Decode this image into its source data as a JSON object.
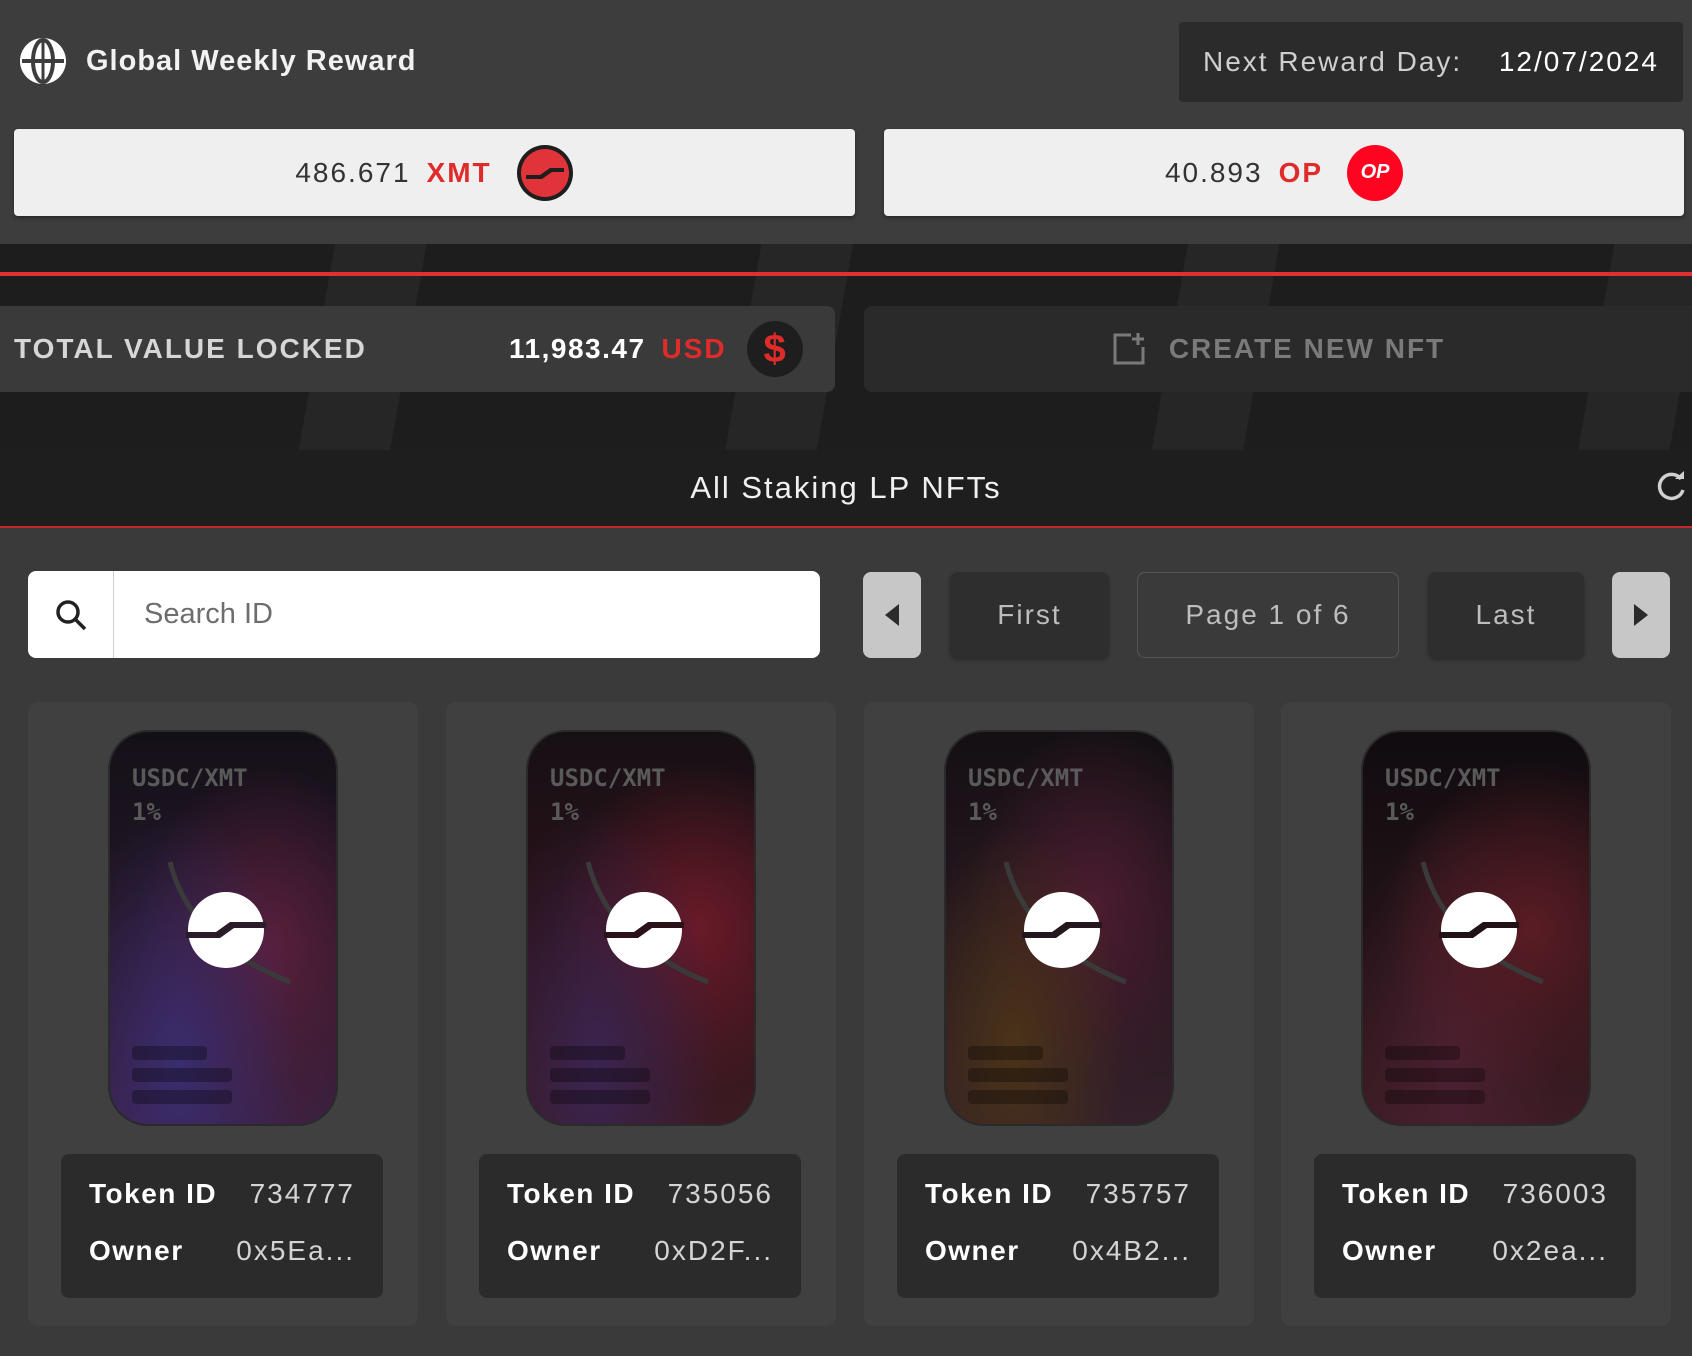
{
  "reward": {
    "title": "Global Weekly Reward",
    "next_label": "Next Reward Day:",
    "next_date": "12/07/2024",
    "xmt_amount": "486.671",
    "xmt_symbol": "XMT",
    "op_amount": "40.893",
    "op_symbol": "OP",
    "op_coin_text": "OP"
  },
  "tvl": {
    "label": "TOTAL VALUE LOCKED",
    "value": "11,983.47",
    "unit": "USD",
    "coin_symbol": "$"
  },
  "create_nft": {
    "label": "CREATE NEW NFT"
  },
  "section": {
    "title": "All Staking LP NFTs"
  },
  "search": {
    "placeholder": "Search ID",
    "value": ""
  },
  "pagination": {
    "first": "First",
    "page_indicator": "Page 1 of 6",
    "last": "Last"
  },
  "labels": {
    "token_id": "Token ID",
    "owner": "Owner"
  },
  "nfts": [
    {
      "pair": "USDC/XMT",
      "fee": "1%",
      "token_id": "734777",
      "owner": "0x5Ea..."
    },
    {
      "pair": "USDC/XMT",
      "fee": "1%",
      "token_id": "735056",
      "owner": "0xD2F..."
    },
    {
      "pair": "USDC/XMT",
      "fee": "1%",
      "token_id": "735757",
      "owner": "0x4B2..."
    },
    {
      "pair": "USDC/XMT",
      "fee": "1%",
      "token_id": "736003",
      "owner": "0x2ea..."
    }
  ],
  "colors": {
    "accent": "#e02b2b",
    "op_brand": "#ff0420"
  },
  "icons": [
    "globe-icon",
    "xmt-coin-icon",
    "op-coin-icon",
    "dollar-icon",
    "add-nft-icon",
    "refresh-icon",
    "search-icon",
    "chevron-left-icon",
    "chevron-right-icon",
    "xmt-logo-icon"
  ]
}
